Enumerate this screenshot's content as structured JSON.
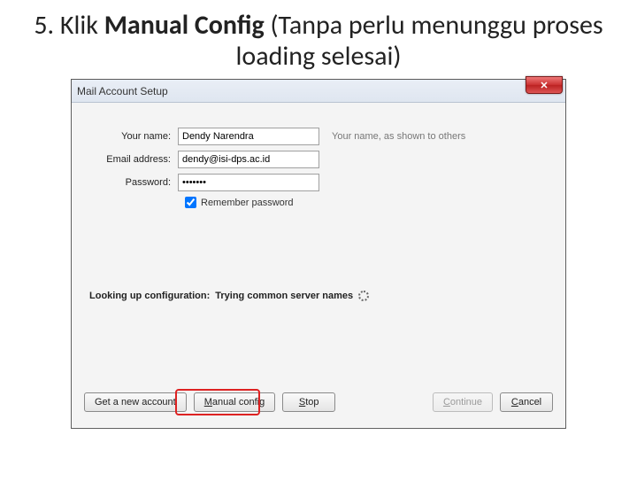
{
  "heading": {
    "prefix": "5. Klik ",
    "bold": "Manual Config",
    "suffix": " (Tanpa perlu menunggu proses loading selesai)"
  },
  "dialog": {
    "title": "Mail Account Setup",
    "close_glyph": "✕",
    "labels": {
      "name": "Your name:",
      "email": "Email address:",
      "password": "Password:",
      "remember": "Remember password"
    },
    "fields": {
      "name_value": "Dendy Narendra",
      "email_value": "dendy@isi-dps.ac.id",
      "password_value": "•••••••"
    },
    "hints": {
      "name": "Your name, as shown to others"
    },
    "remember_checked": true,
    "status": {
      "label": "Looking up configuration:",
      "text": "Trying common server names"
    },
    "buttons": {
      "get_new": "Get a new account",
      "manual_u": "M",
      "manual_rest": "anual config",
      "stop_u": "S",
      "stop_rest": "top",
      "continue_u": "C",
      "continue_rest": "ontinue",
      "cancel_u": "C",
      "cancel_rest": "ancel"
    }
  }
}
